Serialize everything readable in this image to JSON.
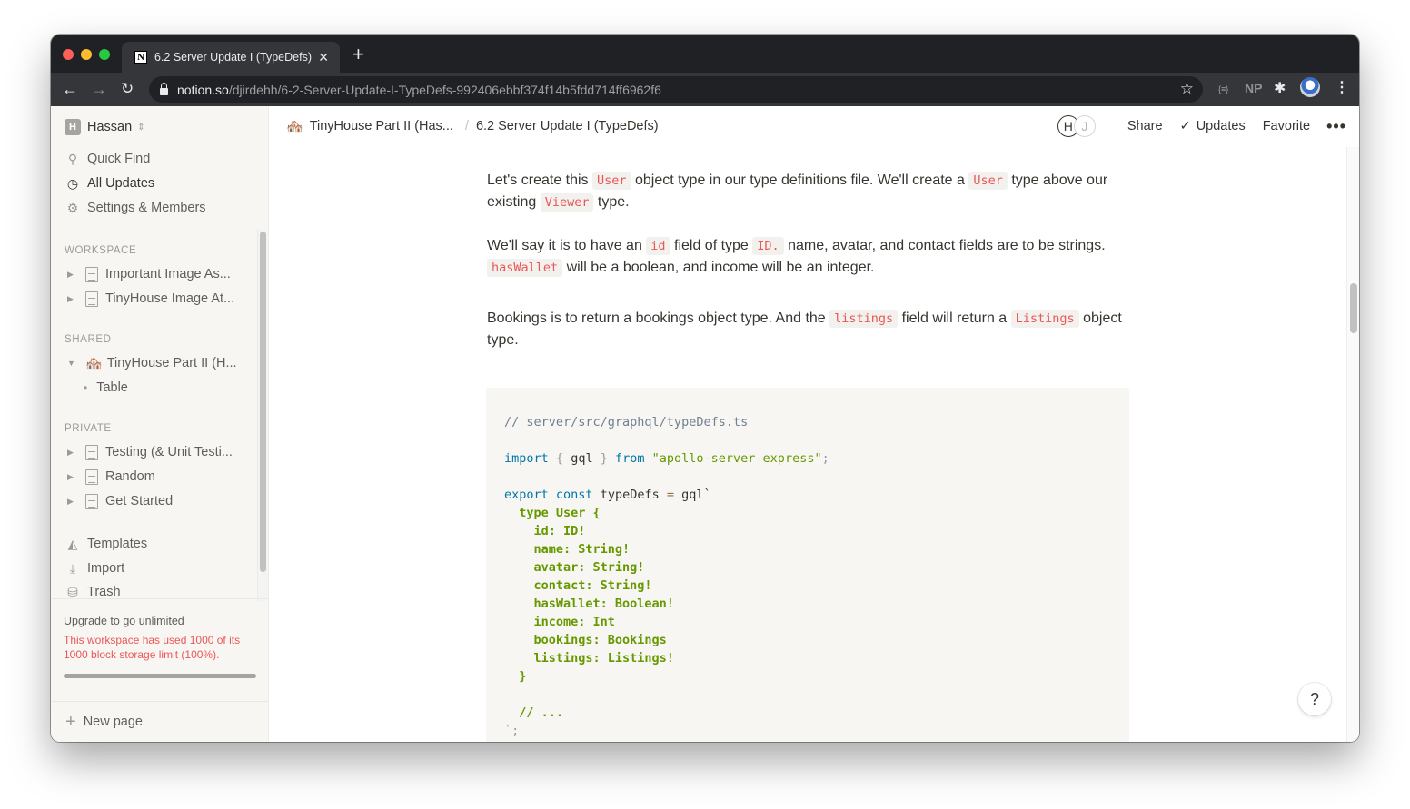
{
  "browser": {
    "tab": {
      "title": "6.2 Server Update I (TypeDefs)",
      "favicon": "notion-icon",
      "favicon_glyph": "N",
      "close_glyph": "✕"
    },
    "new_tab_glyph": "+",
    "nav": {
      "back_glyph": "←",
      "forward_glyph": "→",
      "reload_glyph": "↻"
    },
    "url": {
      "host": "notion.so",
      "path": "/djirdehh/6-2-Server-Update-I-TypeDefs-992406ebbf374f14b5fdd714ff6962f6"
    },
    "bookmark_glyph": "☆",
    "extensions": [
      {
        "name": "json-viewer-icon",
        "glyph": "{≡}"
      },
      {
        "name": "np-extension-icon",
        "glyph": "NP"
      },
      {
        "name": "extensions-puzzle-icon",
        "glyph": "✱"
      },
      {
        "name": "profile-avatar-icon",
        "glyph": ""
      },
      {
        "name": "browser-menu-icon",
        "glyph": "⋮"
      }
    ]
  },
  "sidebar": {
    "workspace": {
      "initial": "H",
      "name": "Hassan",
      "switch_glyph": "⌃⌄"
    },
    "nav": [
      {
        "label": "Quick Find",
        "icon": "search-icon",
        "glyph": "⚲",
        "active": false
      },
      {
        "label": "All Updates",
        "icon": "clock-icon",
        "glyph": "◷",
        "active": true
      },
      {
        "label": "Settings & Members",
        "icon": "gear-icon",
        "glyph": "⚙",
        "active": false
      }
    ],
    "sections": {
      "workspace": {
        "label": "WORKSPACE",
        "pages": [
          {
            "title": "Important Image As..."
          },
          {
            "title": "TinyHouse Image At..."
          }
        ]
      },
      "shared": {
        "label": "SHARED",
        "pages": [
          {
            "title": "TinyHouse Part II (H...",
            "emoji": "🏘️",
            "expanded": true,
            "children": [
              {
                "title": "Table"
              }
            ]
          }
        ]
      },
      "private": {
        "label": "PRIVATE",
        "pages": [
          {
            "title": "Testing (& Unit Testi..."
          },
          {
            "title": "Random"
          },
          {
            "title": "Get Started"
          }
        ]
      }
    },
    "tools": [
      {
        "label": "Templates",
        "icon": "templates-icon",
        "glyph": "◭"
      },
      {
        "label": "Import",
        "icon": "import-icon",
        "glyph": "⤓"
      },
      {
        "label": "Trash",
        "icon": "trash-icon",
        "glyph": "⛁"
      }
    ],
    "upgrade": {
      "title": "Upgrade to go unlimited",
      "warning": "This workspace has used 1000 of its 1000 block storage limit (100%).",
      "used": 1000,
      "limit": 1000,
      "percent": 100
    },
    "new_page": {
      "label": "New page",
      "glyph": "+"
    }
  },
  "topbar": {
    "breadcrumb": [
      {
        "label": "TinyHouse Part II (Has...",
        "emoji": "🏘️"
      },
      {
        "label": "6.2 Server Update I (TypeDefs)"
      }
    ],
    "separator": "/",
    "collaborators": [
      "H",
      "J"
    ],
    "share_label": "Share",
    "updates_label": "Updates",
    "updates_check": "✓",
    "favorite_label": "Favorite",
    "more_glyph": "•••"
  },
  "content": {
    "p1": {
      "t1": "Let's create this ",
      "c1": "User",
      "t2": " object type in our type definitions file. We'll create a ",
      "c2": "User",
      "t3": " type above our existing ",
      "c3": "Viewer",
      "t4": " type."
    },
    "p2": {
      "t1": "We'll say it is to have an ",
      "c1": "id",
      "t2": " field of type ",
      "c2": "ID.",
      "t3": " name, avatar, and contact fields are to be strings. ",
      "c3": "hasWallet",
      "t4": " will be a boolean, and income will be an integer."
    },
    "p3": {
      "t1": "Bookings is to return a bookings object type. And the ",
      "c1": "listings",
      "t2": " field will return a ",
      "c2": "Listings",
      "t3": " object type."
    },
    "code": {
      "comment": "// server/src/graphql/typeDefs.ts",
      "import_kw": "import",
      "import_open": "{",
      "import_name": " gql ",
      "import_close": "}",
      "from_kw": "from",
      "import_src": "\"apollo-server-express\"",
      "semi": ";",
      "export_kw": "export",
      "const_kw": "const",
      "var_name": " typeDefs ",
      "eq": "=",
      "tag": " gql`",
      "gql_lines": [
        "  type User {",
        "    id: ID!",
        "    name: String!",
        "    avatar: String!",
        "    contact: String!",
        "    hasWallet: Boolean!",
        "    income: Int",
        "    bookings: Bookings",
        "    listings: Listings!",
        "  }",
        "",
        "  // ..."
      ],
      "closing": "`;"
    },
    "help_glyph": "?"
  }
}
